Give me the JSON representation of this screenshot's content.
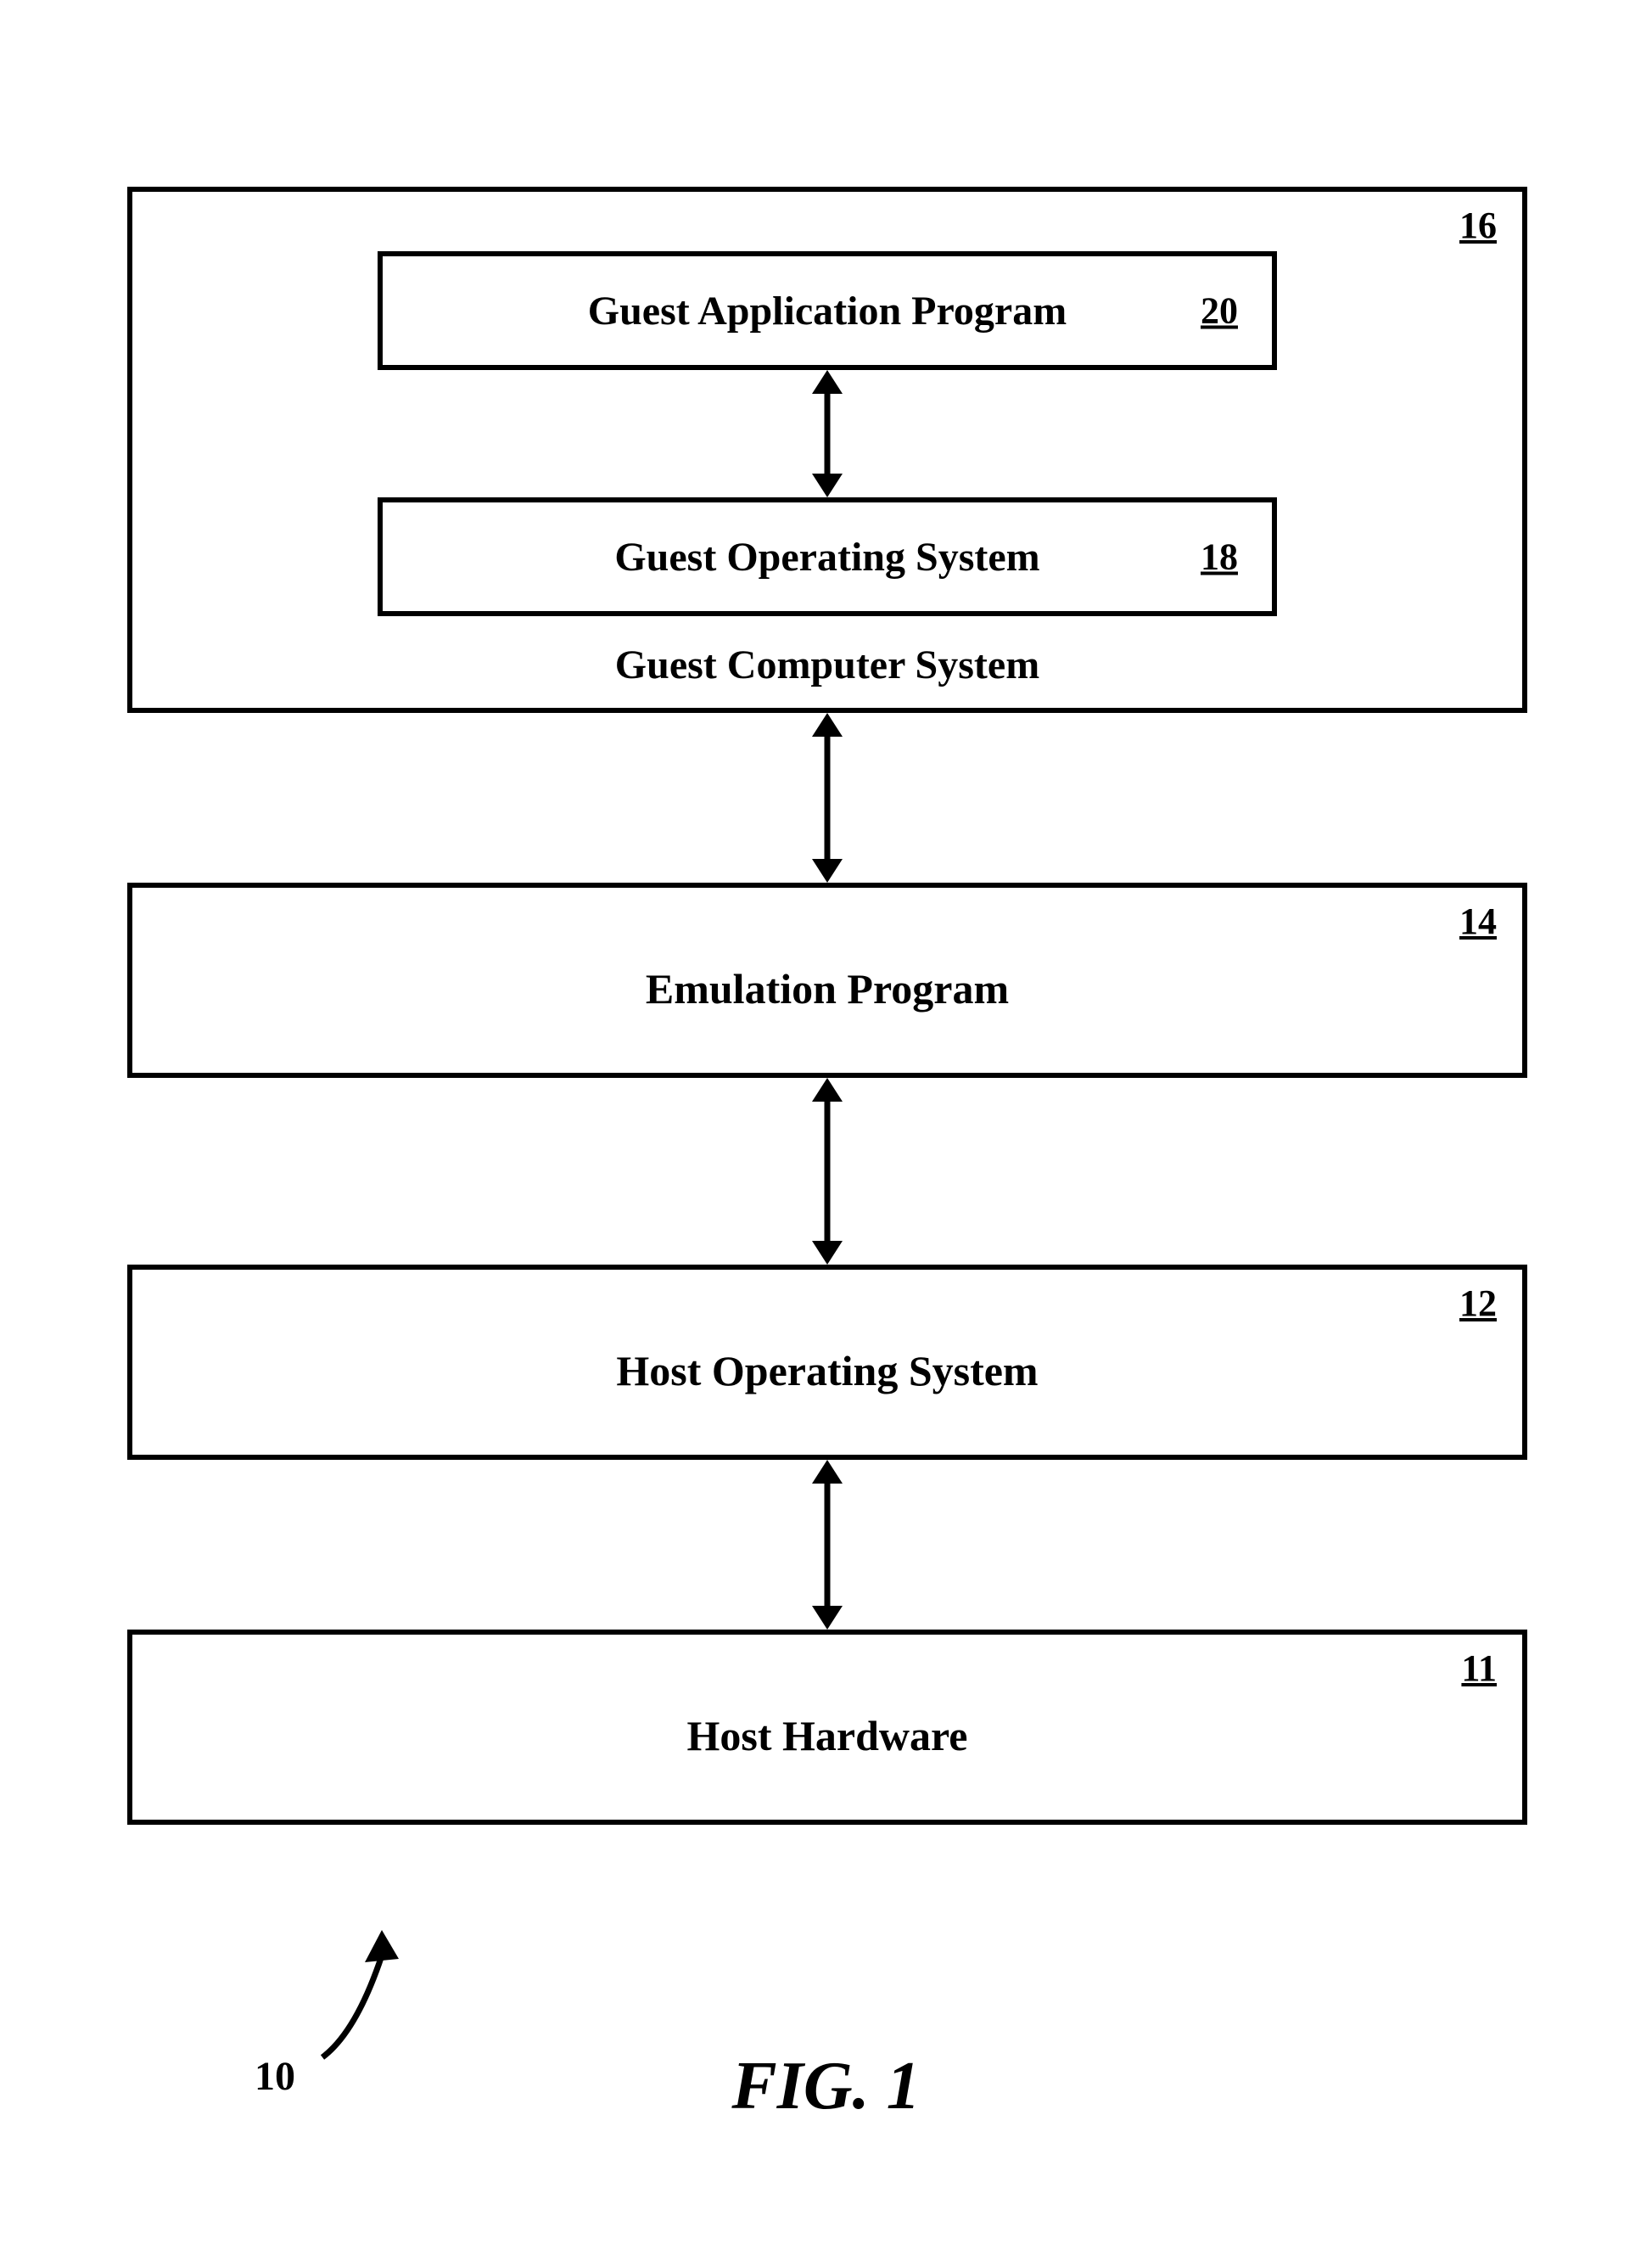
{
  "boxes": {
    "guest_outer": {
      "ref": "16",
      "caption": "Guest Computer System"
    },
    "guest_app": {
      "ref": "20",
      "label": "Guest Application Program"
    },
    "guest_os": {
      "ref": "18",
      "label": "Guest Operating System"
    },
    "emulation": {
      "ref": "14",
      "label": "Emulation Program"
    },
    "host_os": {
      "ref": "12",
      "label": "Host Operating System"
    },
    "host_hw": {
      "ref": "11",
      "label": "Host Hardware"
    }
  },
  "figure": {
    "ref_10": "10",
    "caption": "FIG. 1"
  }
}
